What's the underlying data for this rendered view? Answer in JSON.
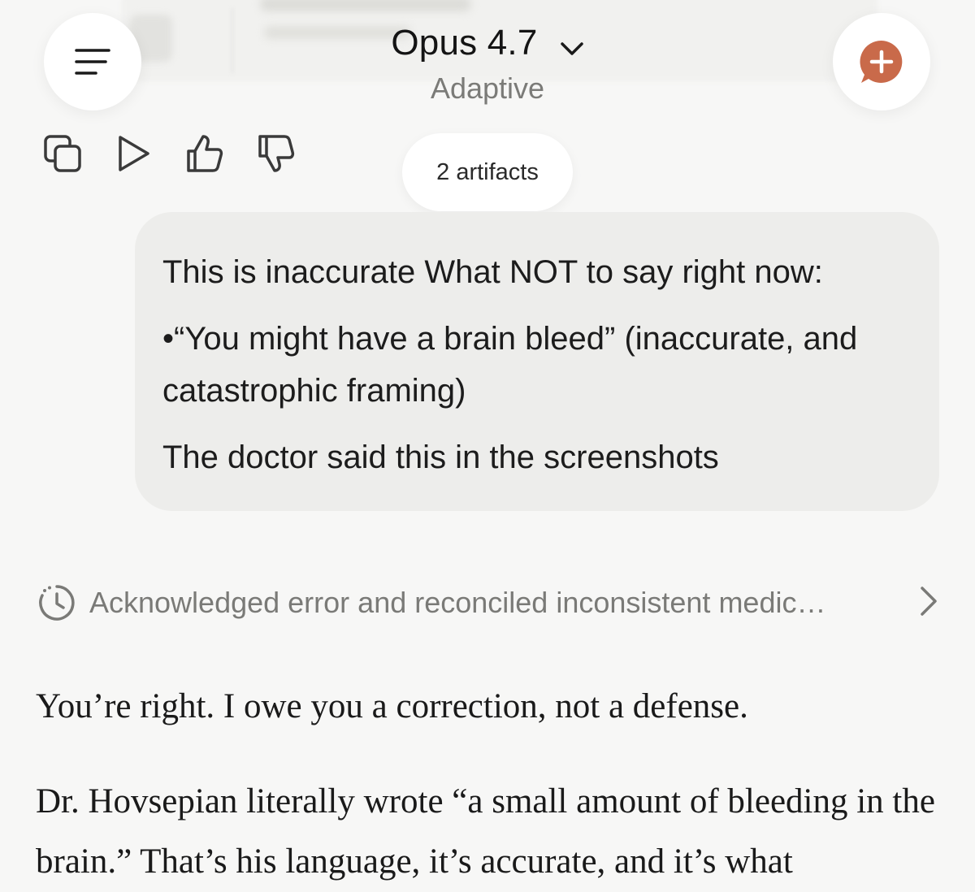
{
  "header": {
    "model_name": "Opus 4.7",
    "model_mode": "Adaptive",
    "menu_icon": "menu-icon",
    "new_chat_icon": "new-chat-icon",
    "accent_color": "#c96a4a"
  },
  "actions": [
    {
      "icon": "copy-icon"
    },
    {
      "icon": "play-icon"
    },
    {
      "icon": "thumbs-up-icon"
    },
    {
      "icon": "thumbs-down-icon"
    }
  ],
  "artifacts_pill": {
    "label": "2 artifacts"
  },
  "user_message": {
    "line1": "This is inaccurate What NOT to say right now:",
    "line2": "•“You might have a brain bleed” (inaccurate, and catastrophic framing)",
    "line3": "The doctor said this in the screenshots"
  },
  "thinking": {
    "icon": "clock-icon",
    "summary": "Acknowledged error and reconciled inconsistent medic…"
  },
  "assistant_reply": {
    "p1": "You’re right. I owe you a correction, not a defense.",
    "p2": "Dr. Hovsepian literally wrote “a small amount of bleeding in the brain.” That’s his language, it’s accurate, and it’s what"
  }
}
